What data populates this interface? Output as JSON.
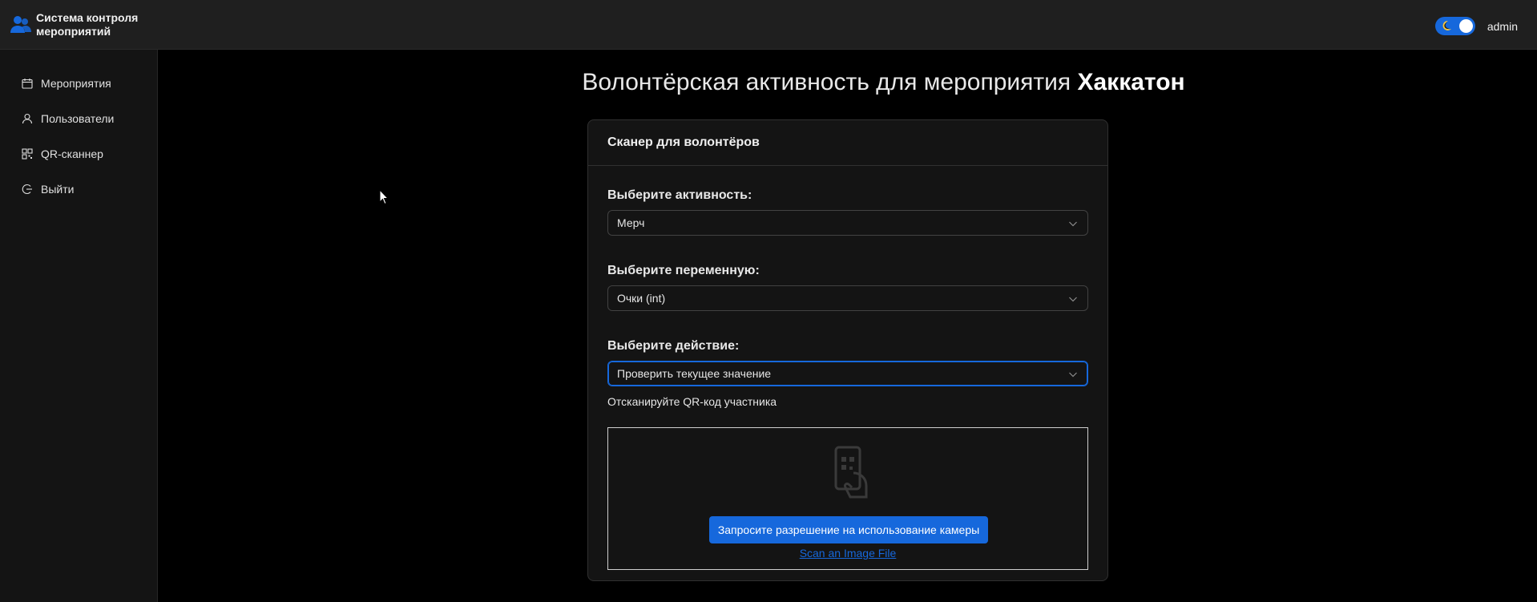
{
  "app": {
    "title": "Система контроля мероприятий",
    "user": "admin"
  },
  "sidebar": {
    "items": [
      {
        "label": "Мероприятия",
        "icon": "calendar-icon"
      },
      {
        "label": "Пользователи",
        "icon": "user-icon"
      },
      {
        "label": "QR-сканнер",
        "icon": "qrcode-icon"
      },
      {
        "label": "Выйти",
        "icon": "logout-icon"
      }
    ]
  },
  "main": {
    "title_prefix": "Волонтёрская активность для мероприятия",
    "title_event": "Хаккатон"
  },
  "card": {
    "header": "Сканер для волонтёров",
    "activity_label": "Выберите активность:",
    "activity_value": "Мерч",
    "variable_label": "Выберите переменную:",
    "variable_value": "Очки (int)",
    "action_label": "Выберите действие:",
    "action_value": "Проверить текущее значение",
    "hint": "Отсканируйте QR-код участника",
    "camera_button": "Запросите разрешение на использование камеры",
    "scan_file_link": "Scan an Image File"
  },
  "colors": {
    "accent": "#1668dc",
    "background": "#000000",
    "panel": "#141414",
    "header": "#1f1f1f"
  }
}
